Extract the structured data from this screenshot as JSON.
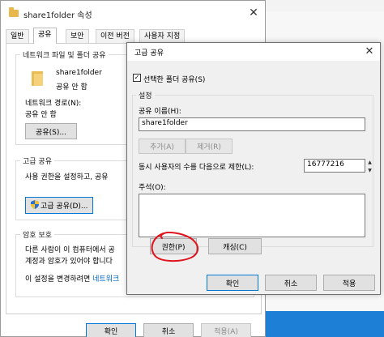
{
  "props_window": {
    "title": "share1folder 속성",
    "close_glyph": "✕",
    "tabs": [
      {
        "label": "일반"
      },
      {
        "label": "공유"
      },
      {
        "label": "보안"
      },
      {
        "label": "이전 버전"
      },
      {
        "label": "사용자 지정"
      }
    ],
    "network_group": {
      "label": "네트워크 파일 및 폴더 공유",
      "folder_name": "share1folder",
      "folder_state": "공유 안 함",
      "path_label": "네트워크 경로(N):",
      "path_value": "공유 안 함",
      "share_button": "공유(S)..."
    },
    "advanced_group": {
      "label": "고급 공유",
      "desc": "사용 권한을 설정하고, 공유",
      "button": "고급 공유(D)..."
    },
    "password_group": {
      "label": "암호 보호",
      "line1": "다른 사람이 이 컴퓨터에서 공",
      "line2": "계정과 암호가 있어야 합니다",
      "line3_prefix": "이 설정을 변경하려면 ",
      "line3_link": "네트워크"
    },
    "buttons": {
      "ok": "확인",
      "cancel": "취소",
      "apply": "적용(A)"
    }
  },
  "advanced_dialog": {
    "title": "고급 공유",
    "close_glyph": "✕",
    "share_checkbox": {
      "label": "선택한 폴더 공유(S)",
      "checked": true,
      "mark": "✓"
    },
    "settings_label": "설정",
    "share_name_label": "공유 이름(H):",
    "share_name_value": "share1folder",
    "add_button": "추가(A)",
    "remove_button": "제거(R)",
    "limit_label": "동시 사용자의 수를 다음으로 제한(L):",
    "limit_value": "16777216",
    "spin_up": "▲",
    "spin_down": "▼",
    "comment_label": "주석(O):",
    "permissions_button": "권한(P)",
    "caching_button": "캐싱(C)",
    "buttons": {
      "ok": "확인",
      "cancel": "취소",
      "apply": "적용"
    }
  },
  "colors": {
    "annotation": "#e0141e",
    "link": "#0066cc",
    "focus": "#0078d7"
  }
}
